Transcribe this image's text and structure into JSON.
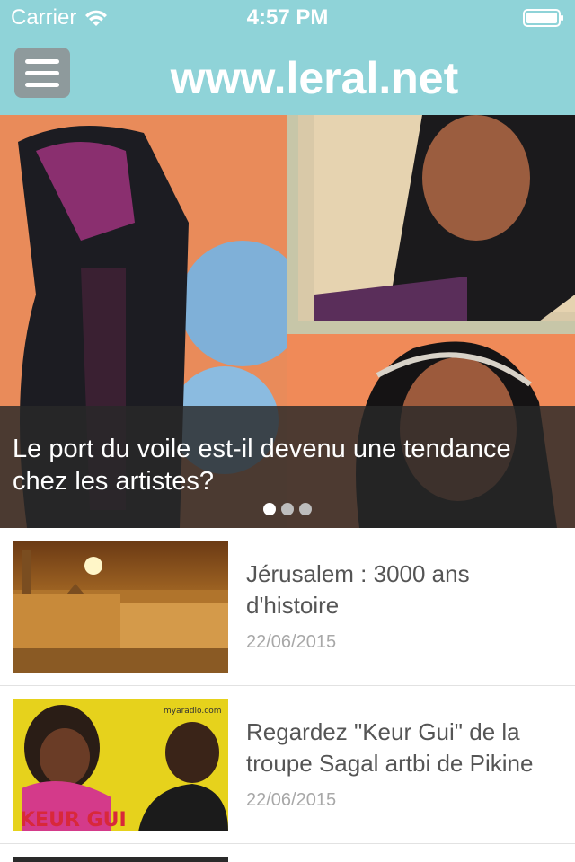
{
  "status_bar": {
    "carrier": "Carrier",
    "time": "4:57 PM"
  },
  "header": {
    "title": "www.leral.net"
  },
  "hero": {
    "title": "Le port du voile est-il devenu une tendance chez les artistes?",
    "pages": 3,
    "active_page": 1
  },
  "news": [
    {
      "title": "Jérusalem : 3000 ans d'histoire",
      "date": "22/06/2015"
    },
    {
      "title": "Regardez \"Keur Gui\" de la troupe Sagal artbi de Pikine",
      "date": "22/06/2015"
    }
  ],
  "thumb_text": {
    "keurgui": "KEUR GUI",
    "watermark": "myaradio.com"
  },
  "colors": {
    "header_bg": "#8fd3d8",
    "menu_button": "#8e9a9c",
    "caption_bg": "#282828",
    "date": "#a8a8a8"
  }
}
